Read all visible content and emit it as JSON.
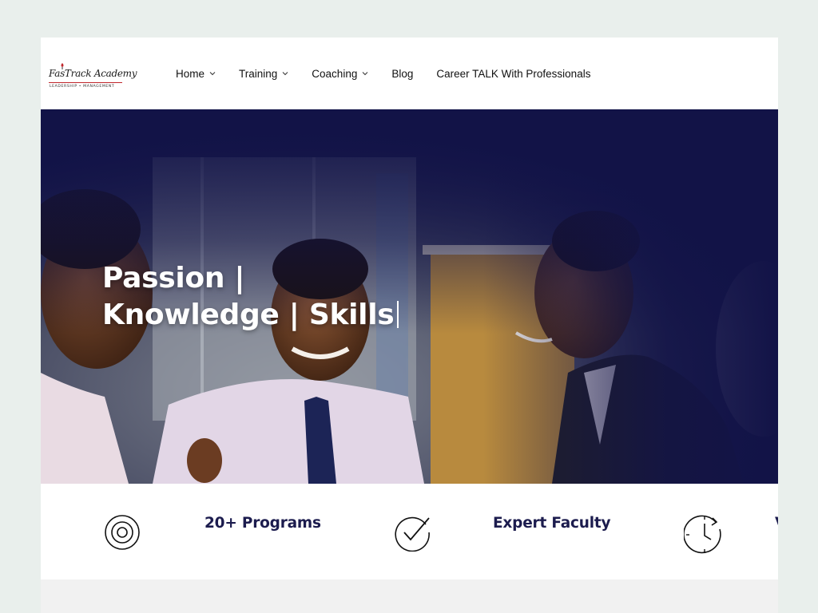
{
  "brand": {
    "logo_text": "FasTrack Academy",
    "logo_subtext": "LEADERSHIP • MANAGEMENT"
  },
  "nav": {
    "items": [
      {
        "label": "Home",
        "has_dropdown": true
      },
      {
        "label": "Training",
        "has_dropdown": true
      },
      {
        "label": "Coaching",
        "has_dropdown": true
      },
      {
        "label": "Blog",
        "has_dropdown": false
      },
      {
        "label": "Career TALK With Professionals",
        "has_dropdown": false
      }
    ]
  },
  "hero": {
    "line1": "Passion |",
    "line2": "Knowledge | Skills",
    "overlay_color": "#121347"
  },
  "features": [
    {
      "label": "20+ Programs",
      "icon": "target-icon"
    },
    {
      "label": "Expert Faculty",
      "icon": "check-circle-icon"
    },
    {
      "label": "V",
      "icon": "clock-icon"
    }
  ],
  "colors": {
    "navy": "#1c1c4e",
    "accent_red": "#c0282d",
    "page_bg": "#e9efec"
  }
}
